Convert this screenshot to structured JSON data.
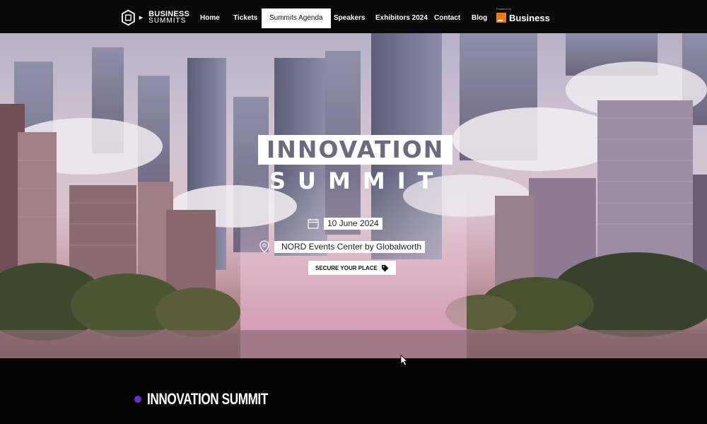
{
  "brand": {
    "line1": "BUSINESS",
    "line2": "SUMMITS"
  },
  "nav": {
    "items": [
      {
        "label": "Home"
      },
      {
        "label": "Tickets"
      },
      {
        "label": "Summits Agenda"
      },
      {
        "label": "Speakers"
      },
      {
        "label": "Exhibitors 2024"
      },
      {
        "label": "Contact"
      },
      {
        "label": "Blog"
      }
    ],
    "active": "Summits Agenda"
  },
  "sponsor": {
    "tag": "Powered by",
    "name": "Business",
    "color": "#ff7900"
  },
  "hero": {
    "title_line1": "INNOVATION",
    "title_line2": "SUMMIT",
    "date": "10 June 2024",
    "venue": "NORD Events Center by Globalworth",
    "cta": "SECURE YOUR PLACE",
    "cta_icon": "tag-icon"
  },
  "section": {
    "title": "INNOVATION SUMMIT",
    "accent": "#6b2fc9"
  }
}
